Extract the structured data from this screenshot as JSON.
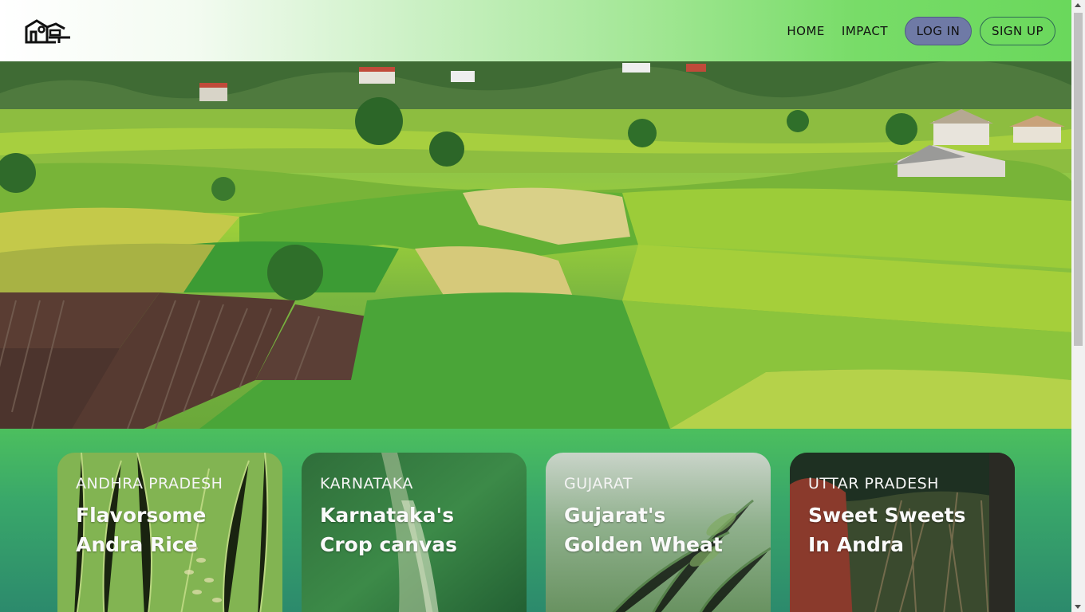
{
  "header": {
    "logo_icon": "farm-logo-icon",
    "nav": [
      {
        "label": "HOME"
      },
      {
        "label": "IMPACT"
      }
    ],
    "login_label": "LOG IN",
    "signup_label": "SIGN UP"
  },
  "hero": {
    "image": "aerial view of terraced rice fields with village houses"
  },
  "cards": [
    {
      "region": "ANDHRA PRADESH",
      "title": "Flavorsome Andra Rice"
    },
    {
      "region": "KARNATAKA",
      "title": "Karnataka's Crop canvas"
    },
    {
      "region": "GUJARAT",
      "title": "Gujarat's Golden Wheat"
    },
    {
      "region": "UTTAR PRADESH",
      "title": "Sweet Sweets In Andra"
    }
  ],
  "colors": {
    "header_gradient_end": "#6ad85c",
    "login_button": "#6f7aa6",
    "section_green": "#3fae5e"
  }
}
